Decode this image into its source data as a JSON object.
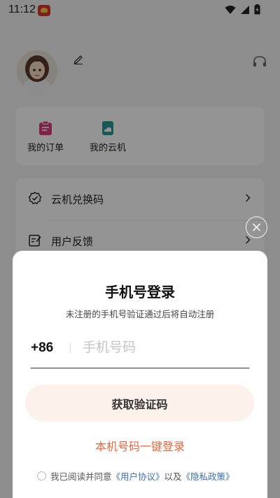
{
  "status_bar": {
    "time": "11:12"
  },
  "profile": {
    "avatar": "avatar-image"
  },
  "shortcuts": [
    {
      "label": "我的订单",
      "icon": "order-icon"
    },
    {
      "label": "我的云机",
      "icon": "cloud-phone-icon"
    }
  ],
  "menu": [
    {
      "label": "云机兑换码",
      "icon": "redeem-code-icon"
    },
    {
      "label": "用户反馈",
      "icon": "feedback-icon"
    }
  ],
  "login": {
    "title": "手机号登录",
    "subtitle": "未注册的手机号验证通过后将自动注册",
    "country_code": "+86",
    "phone_placeholder": "手机号码",
    "phone_value": "",
    "get_code_label": "获取验证码",
    "one_click_label": "本机号码一键登录",
    "agree_prefix": "我已阅读并同意",
    "user_agreement": "《用户协议》",
    "and": "以及",
    "privacy_policy": "《隐私政策》"
  },
  "colors": {
    "accent": "#e8663d",
    "button_bg": "#fdf1ec",
    "link": "#3d6fb5",
    "order_icon": "#d93f7c",
    "cloud_icon": "#2a9a94"
  }
}
